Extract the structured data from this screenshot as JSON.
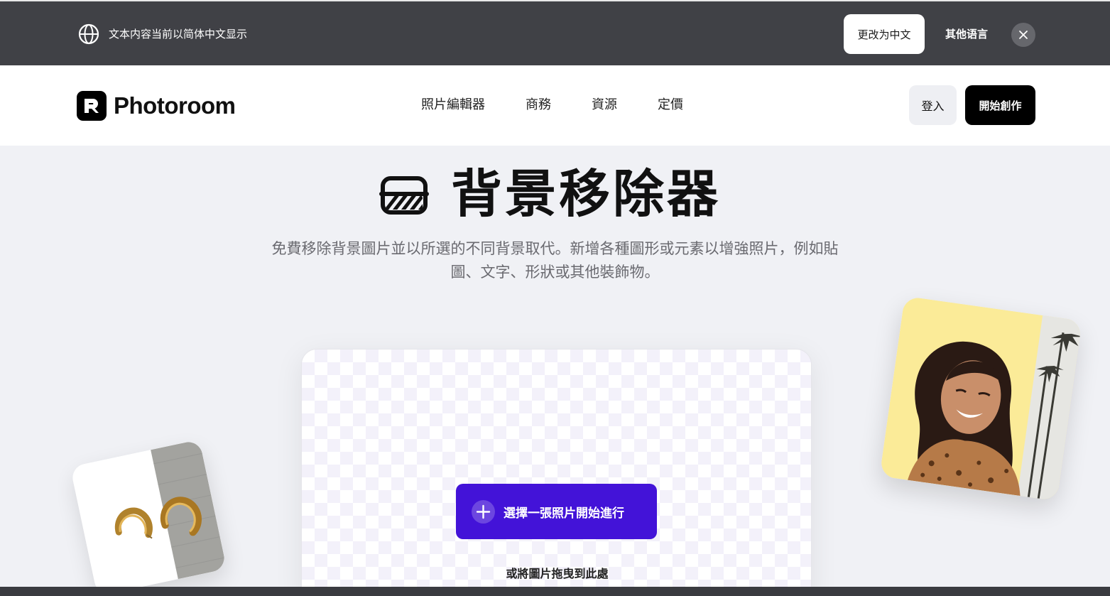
{
  "language_banner": {
    "notice": "文本内容当前以简体中文显示",
    "change_button": "更改为中文",
    "other_languages": "其他语言",
    "icons": {
      "globe": "globe-icon",
      "close": "close-icon"
    }
  },
  "header": {
    "brand": "Photoroom",
    "nav": [
      "照片編輯器",
      "商務",
      "資源",
      "定價"
    ],
    "login": "登入",
    "start_creating": "開始創作"
  },
  "hero": {
    "title": "背景移除器",
    "description": "免費移除背景圖片並以所選的不同背景取代。新增各種圖形或元素以增強照片，例如貼圖、文字、形狀或其他裝飾物。",
    "icon": "background-remover-icon"
  },
  "upload": {
    "choose_button": "選擇一張照片開始進行",
    "drop_hint": "或將圖片拖曳到此處"
  },
  "colors": {
    "banner_bg": "#404146",
    "primary_button": "#4313d8",
    "page_bg": "#f0f1f5",
    "portrait_bg": "#fbeb98"
  }
}
